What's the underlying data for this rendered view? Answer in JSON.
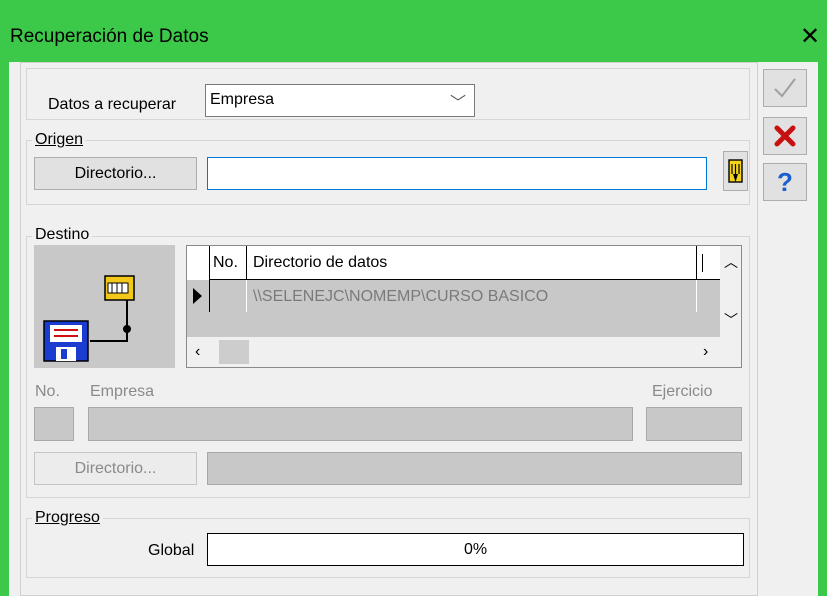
{
  "window": {
    "title": "Recuperación de Datos",
    "accent": "#3cc94a"
  },
  "datos": {
    "label": "Datos a recuperar",
    "selected": "Empresa"
  },
  "origen": {
    "title": "Origen",
    "button": "Directorio...",
    "path": ""
  },
  "destino": {
    "title": "Destino",
    "grid": {
      "headers": [
        "No.",
        "Directorio de datos"
      ],
      "rows": [
        {
          "no": "",
          "directorio": "\\\\SELENEJC\\NOMEMP\\CURSO BASICO"
        }
      ]
    },
    "no_label": "No.",
    "empresa_label": "Empresa",
    "ejercicio_label": "Ejercicio",
    "button": "Directorio..."
  },
  "progreso": {
    "title": "Progreso",
    "global_label": "Global",
    "value": 0,
    "text": "0%"
  },
  "icons": {
    "ok": "checkmark-icon",
    "cancel": "red-x-icon",
    "help": "question-icon",
    "browse": "pointing-hand-icon"
  }
}
